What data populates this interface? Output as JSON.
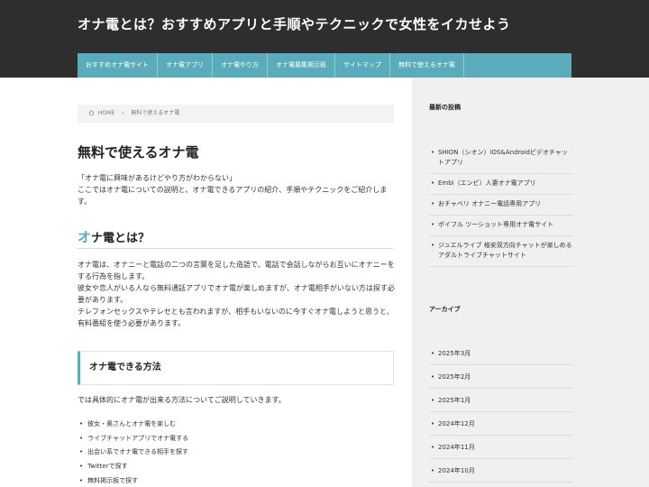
{
  "site": {
    "title": "オナ電とは？おすすめアプリと手順やテクニックで女性をイカせよう"
  },
  "nav": {
    "items": [
      {
        "label": "おすすめオナ電サイト"
      },
      {
        "label": "オナ電アプリ"
      },
      {
        "label": "オナ電やり方"
      },
      {
        "label": "オナ電募集掲示板"
      },
      {
        "label": "サイトマップ"
      },
      {
        "label": "無料で使えるオナ電"
      }
    ]
  },
  "breadcrumb": {
    "home": "HOME",
    "separator": "›",
    "current": "無料で使えるオナ電"
  },
  "article": {
    "title": "無料で使えるオナ電",
    "intro_lines": [
      "「オナ電に興味があるけどやり方がわからない」",
      "ここではオナ電についての説明と、オナ電できるアプリの紹介、手順やテクニックをご紹介します。"
    ],
    "h2_first_char": "オ",
    "h2_rest": "ナ電とは？",
    "body_lines": [
      "オナ電は、オナニーと電話の二つの言葉を足した造語で、電話で会話しながらお互いにオナニーをする行為を指します。",
      "彼女や恋人がいる人なら無料通話アプリでオナ電が楽しめますが、オナ電相手がいない方は探す必要があります。",
      "テレフォンセックスやテレセとも言われますが、相手もいないのに今すぐオナ電しようと思うと、有料番組を使う必要があります。"
    ],
    "h3": "オナ電できる方法",
    "method_text": "では具体的にオナ電が出来る方法についてご説明していきます。",
    "methods": [
      "彼女・奥さんとオナ電を楽しむ",
      "ライブチャットアプリでオナ電する",
      "出会い系でオナ電できる相手を探す",
      "Twitterで探す",
      "無料掲示板で探す"
    ]
  },
  "sidebar": {
    "recent_title": "最新の投稿",
    "recent_posts": [
      "SHION（シオン）iOS&Androidビデオチャットアプリ",
      "Embi（エンビ）人妻オナ電アプリ",
      "おチャベリ オナニー電話専用アプリ",
      "ボイフル ツーショット専用オナ電サイト",
      "ジュエルライブ 格安双方向チャットが楽しめるアダルトライブチャットサイト"
    ],
    "archive_title": "アーカイブ",
    "archives": [
      "2025年3月",
      "2025年2月",
      "2025年1月",
      "2024年12月",
      "2024年11月",
      "2024年10月"
    ]
  },
  "colors": {
    "header_bg": "#2e2e2e",
    "nav_bg": "#5aacbc",
    "accent": "#5aacbc",
    "sidebar_bg": "#f0f0f0"
  }
}
